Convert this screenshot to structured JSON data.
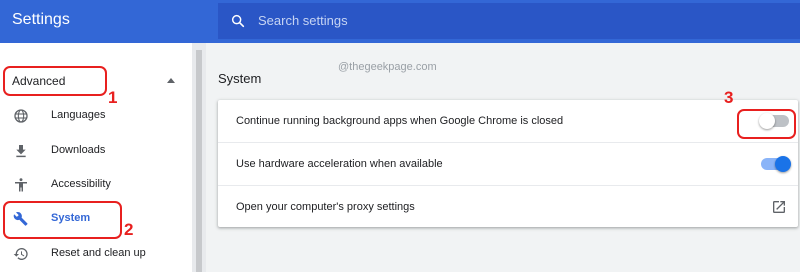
{
  "header": {
    "title": "Settings",
    "search_placeholder": "Search settings"
  },
  "sidebar": {
    "advanced_label": "Advanced",
    "items": [
      {
        "label": "Languages",
        "icon": "globe-icon"
      },
      {
        "label": "Downloads",
        "icon": "download-icon"
      },
      {
        "label": "Accessibility",
        "icon": "accessibility-icon"
      },
      {
        "label": "System",
        "icon": "wrench-icon",
        "active": true
      },
      {
        "label": "Reset and clean up",
        "icon": "history-icon"
      }
    ]
  },
  "main": {
    "section_title": "System",
    "watermark": "@thegeekpage.com",
    "rows": [
      {
        "label": "Continue running background apps when Google Chrome is closed",
        "control": "toggle",
        "state": "off"
      },
      {
        "label": "Use hardware acceleration when available",
        "control": "toggle",
        "state": "on"
      },
      {
        "label": "Open your computer's proxy settings",
        "control": "external-link-icon"
      }
    ]
  },
  "annotations": {
    "callout_1": "1",
    "callout_2": "2",
    "callout_3": "3"
  },
  "colors": {
    "header": "#3367d6",
    "search_bar": "#2a56c6",
    "accent": "#1a73e8",
    "callout": "#e8201f"
  }
}
